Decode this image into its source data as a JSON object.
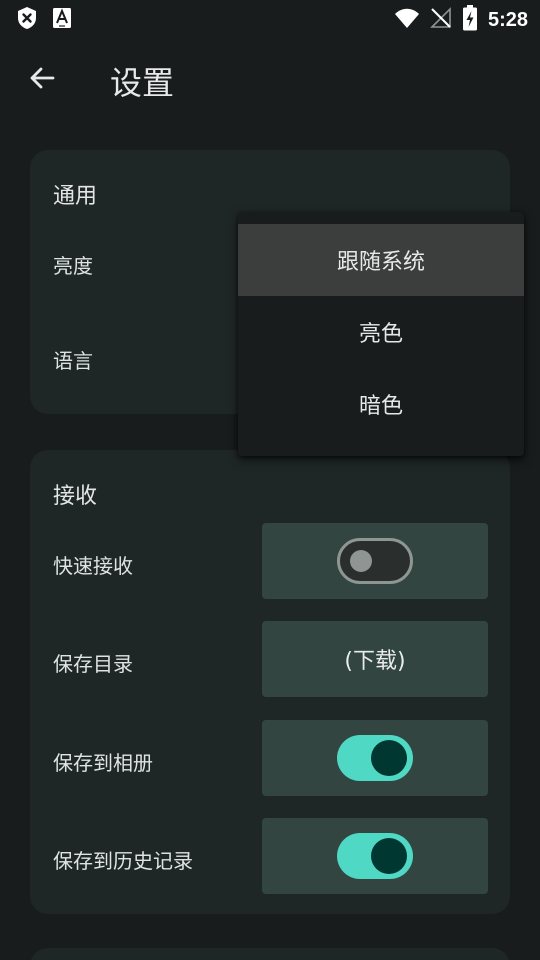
{
  "status_bar": {
    "time": "5:28",
    "left_icons": [
      "shield-x-icon",
      "font-a-icon"
    ],
    "right_icons": [
      "wifi-icon",
      "no-signal-icon",
      "battery-charging-icon"
    ]
  },
  "app_bar": {
    "title": "设置",
    "back_icon": "arrow-left-icon"
  },
  "general": {
    "title": "通用",
    "brightness_label": "亮度",
    "language_label": "语言"
  },
  "brightness_menu": {
    "items": [
      {
        "label": "跟随系统",
        "selected": true
      },
      {
        "label": "亮色",
        "selected": false
      },
      {
        "label": "暗色",
        "selected": false
      }
    ]
  },
  "receive": {
    "title": "接收",
    "quick_receive_label": "快速接收",
    "quick_receive_on": false,
    "save_dir_label": "保存目录",
    "save_dir_value": "(下载)",
    "save_to_album_label": "保存到相册",
    "save_to_album_on": true,
    "save_to_history_label": "保存到历史记录",
    "save_to_history_on": true
  },
  "colors": {
    "background": "#191c1c",
    "card": "#1f2726",
    "control": "#334541",
    "accent": "#4fd8c4"
  }
}
